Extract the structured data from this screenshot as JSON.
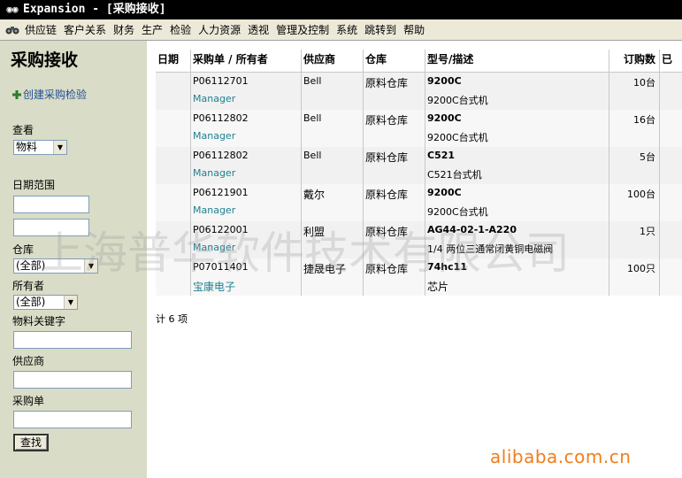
{
  "window": {
    "title": "Expansion - [采购接收]"
  },
  "menu": [
    "供应链",
    "客户关系",
    "财务",
    "生产",
    "检验",
    "人力资源",
    "透视",
    "管理及控制",
    "系统",
    "跳转到",
    "帮助"
  ],
  "sidebar": {
    "title": "采购接收",
    "create_link": "创建采购检验",
    "view_label": "查看",
    "view_value": "物料",
    "date_range_label": "日期范围",
    "warehouse_label": "仓库",
    "warehouse_value": "(全部)",
    "owner_label": "所有者",
    "owner_value": "(全部)",
    "keyword_label": "物料关键字",
    "supplier_label": "供应商",
    "po_label": "采购单",
    "search_button": "查找"
  },
  "table": {
    "headers": [
      "日期",
      "采购单 / 所有者",
      "供应商",
      "仓库",
      "型号/描述",
      "订购数",
      "已"
    ],
    "rows": [
      {
        "po": "P06112701",
        "owner": "Manager",
        "supplier": "Bell",
        "warehouse": "原料仓库",
        "model": "9200C",
        "desc": "9200C台式机",
        "qty": "10台"
      },
      {
        "po": "P06112802",
        "owner": "Manager",
        "supplier": "Bell",
        "warehouse": "原料仓库",
        "model": "9200C",
        "desc": "9200C台式机",
        "qty": "16台"
      },
      {
        "po": "P06112802",
        "owner": "Manager",
        "supplier": "Bell",
        "warehouse": "原料仓库",
        "model": "C521",
        "desc": "C521台式机",
        "qty": "5台"
      },
      {
        "po": "P06121901",
        "owner": "Manager",
        "supplier": "戴尔",
        "warehouse": "原料仓库",
        "model": "9200C",
        "desc": "9200C台式机",
        "qty": "100台"
      },
      {
        "po": "P06122001",
        "owner": "Manager",
        "supplier": "利盟",
        "warehouse": "原料仓库",
        "model": "AG44-02-1-A220",
        "desc": "1/4 两位三通常闭黄铜电磁阀",
        "qty": "1只"
      },
      {
        "po": "P07011401",
        "owner": "宝康电子",
        "supplier": "捷晟电子",
        "warehouse": "原料仓库",
        "model": "74hc11",
        "desc": "芯片",
        "qty": "100只"
      }
    ],
    "count_text": "计 6 项"
  },
  "watermark": "上海普华软件技术有限公司",
  "site_watermark": "alibaba.com.cn"
}
